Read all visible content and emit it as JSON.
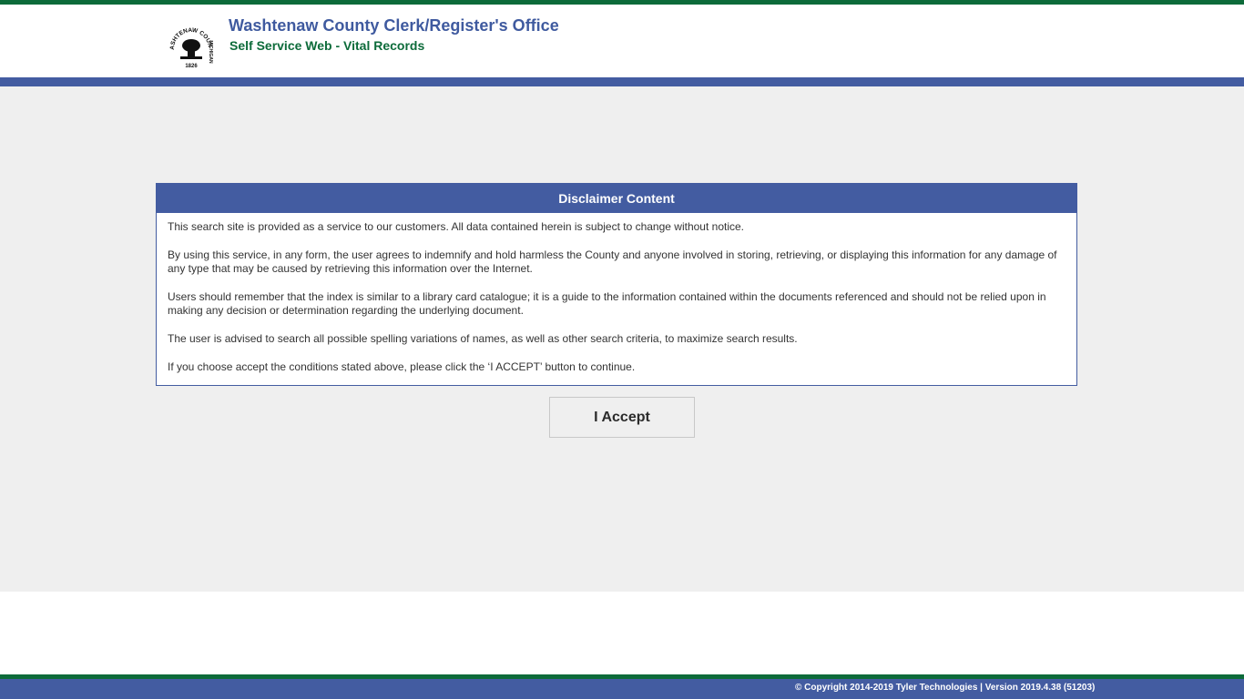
{
  "header": {
    "title": "Washtenaw County Clerk/Register's Office",
    "subtitle": "Self Service Web - Vital Records",
    "logo_text_top": "WASHTENAW COUNTY",
    "logo_text_right": "MICHIGAN",
    "logo_year": "1826",
    "logo_icon": "county-seal-icon"
  },
  "disclaimer": {
    "heading": "Disclaimer Content",
    "paragraphs": [
      "This search site is provided as a service to our customers. All data contained herein is subject to change without notice.",
      "By using this service, in any form, the user agrees to indemnify and hold harmless the County and anyone involved in storing, retrieving, or displaying this information for any damage of any type that may be caused by retrieving this information over the Internet.",
      "Users should remember that the index is similar to a library card catalogue; it is a guide to the information contained within the documents referenced and should not be relied upon in making any decision or determination regarding the underlying document.",
      "The user is advised to search all possible spelling variations of names, as well as other search criteria, to maximize search results.",
      "If you choose accept the conditions stated above, please click the ‘I ACCEPT’ button to continue."
    ]
  },
  "accept_button": {
    "label": "I Accept"
  },
  "footer": {
    "copyright": "© Copyright 2014-2019 Tyler Technologies | Version 2019.4.38 (51203)"
  },
  "colors": {
    "brand_blue": "#435ca1",
    "title_blue": "#3f5a9f",
    "brand_green": "#0d6b3a",
    "main_background": "#efefef"
  }
}
